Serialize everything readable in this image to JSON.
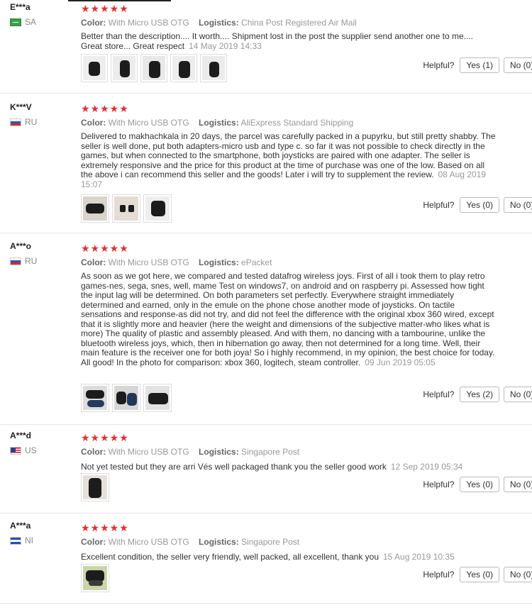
{
  "reviews": [
    {
      "user": "E***a",
      "country": "SA",
      "flag": "sa",
      "stars": "★★★★★",
      "color_label": "Color:",
      "color_value": "With Micro USB OTG",
      "logistics_label": "Logistics:",
      "logistics_value": "China Post Registered Air Mail",
      "text": "Better than the description.... It worth.... Shipment lost in the post the supplier send another one to me.... Great store... Great respect",
      "date": "14 May 2019 14:33",
      "photos": [
        "controller-photo",
        "controller-photo",
        "controller-photo",
        "controller-photo",
        "controller-photo"
      ],
      "helpful_label": "Helpful?",
      "yes_label": "Yes (1)",
      "no_label": "No (0)"
    },
    {
      "user": "K***V",
      "country": "RU",
      "flag": "ru",
      "stars": "★★★★★",
      "color_label": "Color:",
      "color_value": "With Micro USB OTG",
      "logistics_label": "Logistics:",
      "logistics_value": "AliExpress Standard Shipping",
      "text": "Delivered to makhachkala in 20 days, the parcel was carefully packed in a pupyrku, but still pretty shabby. The seller is well done, put both adapters-micro usb and type c. so far it was not possible to check directly in the games, but when connected to the smartphone, both joysticks are paired with one adapter. The seller is extremely responsive and the price for this product at the time of purchase was one of the low. Based on all the above i can recommend this seller and the goods! Later i will try to supplement the review.",
      "date": "08 Aug 2019 15:07",
      "photos": [
        "controller-photo",
        "adapter-photo",
        "controller-photo"
      ],
      "helpful_label": "Helpful?",
      "yes_label": "Yes (0)",
      "no_label": "No (0)"
    },
    {
      "user": "A***o",
      "country": "RU",
      "flag": "ru",
      "stars": "★★★★★",
      "color_label": "Color:",
      "color_value": "With Micro USB OTG",
      "logistics_label": "Logistics:",
      "logistics_value": "ePacket",
      "text": "As soon as we got here, we compared and tested datafrog wireless joys. First of all i took them to play retro games-nes, sega, snes, well, mame Test on windows7, on android and on raspberry pi. Assessed how tight the input lag will be determined. On both parameters set perfectly. Everywhere straight immediately determined and earned, only in the emule on the phone chose another mode of joysticks. On tactile sensations and response-as did not try, and did not feel the difference with the original xbox 360 wired, except that it is slightly more and heavier (here the weight and dimensions of the subjective matter-who likes what is more) The quality of plastic and assembly pleased. And with them, no dancing with a tambourine, unlike the bluetooth wireless joys, which, then in hibernation go away, then not determined for a long time. Well, their main feature is the receiver one for both joya! So i highly recommend, in my opinion, the best choice for today. All good! In the photo for comparison: xbox 360, logitech, steam controller.",
      "date": "09 Jun 2019 05:05",
      "photos": [
        "controller-photo",
        "controller-photo",
        "controller-photo"
      ],
      "helpful_label": "Helpful?",
      "yes_label": "Yes (2)",
      "no_label": "No (0)"
    },
    {
      "user": "A***d",
      "country": "US",
      "flag": "us",
      "stars": "★★★★★",
      "color_label": "Color:",
      "color_value": "With Micro USB OTG",
      "logistics_label": "Logistics:",
      "logistics_value": "Singapore Post",
      "text": "Not yet tested but they are arri Vés well packaged thank you the seller good work",
      "date": "12 Sep 2019 05:34",
      "photos": [
        "controller-photo"
      ],
      "helpful_label": "Helpful?",
      "yes_label": "Yes (0)",
      "no_label": "No (0)"
    },
    {
      "user": "A***a",
      "country": "NI",
      "flag": "ni",
      "stars": "★★★★★",
      "color_label": "Color:",
      "color_value": "With Micro USB OTG",
      "logistics_label": "Logistics:",
      "logistics_value": "Singapore Post",
      "text": "Excellent condition, the seller very friendly, well packed, all excellent, thank you",
      "date": "15 Aug 2019 10:35",
      "photos": [
        "controller-photo"
      ],
      "helpful_label": "Helpful?",
      "yes_label": "Yes (0)",
      "no_label": "No (0)"
    }
  ]
}
